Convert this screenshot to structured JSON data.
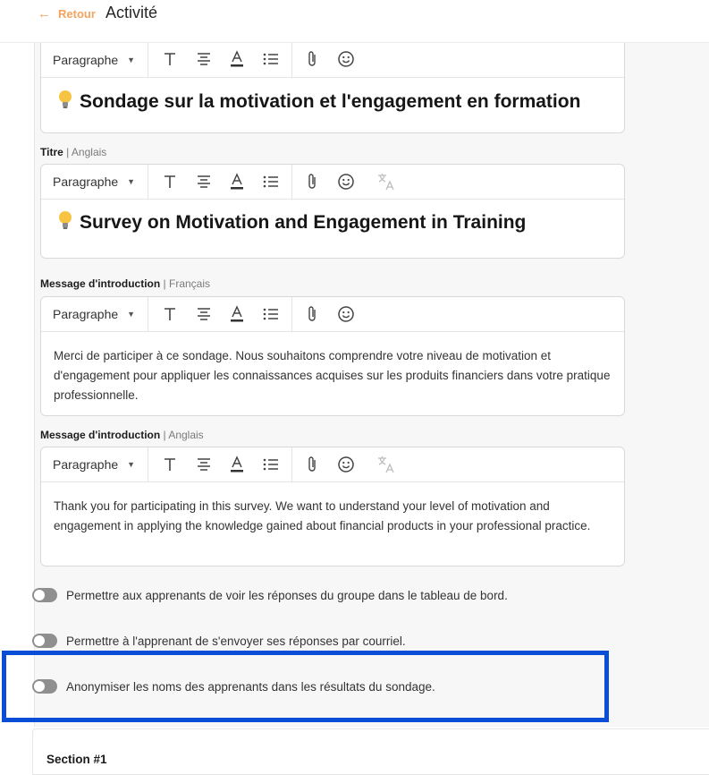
{
  "header": {
    "back_label": "Retour",
    "title": "Activité"
  },
  "toolbar": {
    "paragraph_label": "Paragraphe",
    "icons": [
      "text-icon",
      "align-center-icon",
      "font-color-icon",
      "bullet-list-icon",
      "attachment-icon",
      "emoji-icon",
      "translate-icon"
    ]
  },
  "editors": [
    {
      "label": "",
      "language": "",
      "content": "Sondage sur la motivation et l'engagement en formation",
      "type": "heading"
    },
    {
      "label": "Titre",
      "language": "Anglais",
      "content": "Survey on Motivation and Engagement in Training",
      "type": "heading"
    },
    {
      "label": "Message d'introduction",
      "language": "Français",
      "content": "Merci de participer à ce sondage. Nous souhaitons comprendre votre niveau de motivation et d'engagement pour appliquer les connaissances acquises sur les produits financiers dans votre pratique professionnelle.",
      "type": "paragraph"
    },
    {
      "label": "Message d'introduction",
      "language": "Anglais",
      "content": "Thank you for participating in this survey. We want to understand your level of motivation and engagement in applying the knowledge gained about financial products in your professional practice.",
      "type": "paragraph"
    }
  ],
  "toggles": [
    {
      "label": "Permettre aux apprenants de voir les réponses du groupe dans le tableau de bord.",
      "checked": false
    },
    {
      "label": "Permettre à l'apprenant de s'envoyer ses réponses par courriel.",
      "checked": false
    },
    {
      "label": "Anonymiser les noms des apprenants dans les résultats du sondage.",
      "checked": false
    }
  ],
  "section": {
    "title": "Section #1"
  },
  "colors": {
    "accent": "#f5a35e",
    "highlight": "#0a4ed8",
    "toggle_off": "#8f8f8f"
  }
}
